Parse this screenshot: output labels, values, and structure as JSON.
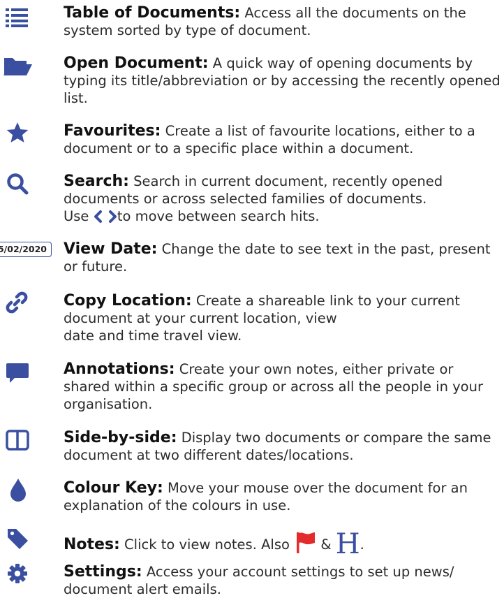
{
  "colors": {
    "accent": "#3a4fa0",
    "flag": "#e32b2b",
    "text": "#2b2b2b"
  },
  "items": [
    {
      "icon": "list-icon",
      "title": "Table of Documents:",
      "desc": " Access all the documents on the system sorted by type of document."
    },
    {
      "icon": "folder-open-icon",
      "title": "Open Document:",
      "desc": " A quick way of opening documents by typing its title/abbreviation or by accessing the recently opened list."
    },
    {
      "icon": "star-icon",
      "title": "Favourites:",
      "desc": " Create a list of favourite locations, either to a document or to a specific place within a document."
    },
    {
      "icon": "search-icon",
      "title": "Search:",
      "desc": " Search in current document, recently opened documents or across selected families of documents.",
      "line3_pre": "Use",
      "line3_post": "to move between search hits."
    },
    {
      "icon": "date-badge",
      "date": "5/02/2020",
      "title": "View Date:",
      "desc": " Change the date to see text in the past, present or future."
    },
    {
      "icon": "link-icon",
      "title": "Copy Location:",
      "desc": " Create a shareable link to your current document at your current location, view",
      "desc2": "date and time travel view."
    },
    {
      "icon": "comment-icon",
      "title": "Annotations:",
      "desc": " Create your own notes, either private or shared within a specific group or across all the people in your organisation."
    },
    {
      "icon": "columns-icon",
      "title": "Side-by-side:",
      "desc": " Display two documents or compare the same document at two different dates/locations."
    },
    {
      "icon": "drop-icon",
      "title": "Colour Key:",
      "desc": " Move your mouse over the document for an explanation of the colours in use."
    },
    {
      "icon": "tag-icon",
      "title": "Notes:",
      "desc": " Click to view notes. Also",
      "amp": "&",
      "h_letter": "H",
      "end": "."
    },
    {
      "icon": "gear-icon",
      "title": "Settings:",
      "desc": " Access your account settings to set up news/ document alert emails."
    }
  ]
}
